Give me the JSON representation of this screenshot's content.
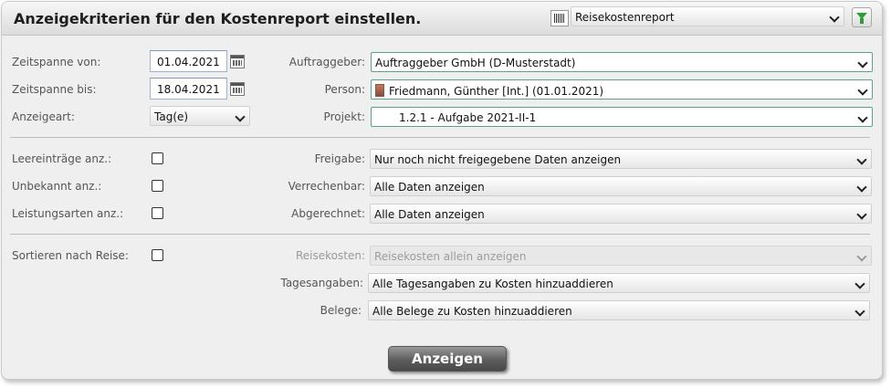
{
  "header": {
    "title": "Anzeigekriterien für den Kostenreport einstellen.",
    "report_select": "Reisekostenreport"
  },
  "row1": {
    "from_label": "Zeitspanne von:",
    "from_value": "01.04.2021",
    "client_label": "Auftraggeber:",
    "client_value": "Auftraggeber GmbH (D-Musterstadt)"
  },
  "row2": {
    "to_label": "Zeitspanne bis:",
    "to_value": "18.04.2021",
    "person_label": "Person:",
    "person_value": "Friedmann, Günther [Int.] (01.01.2021)"
  },
  "row3": {
    "display_label": "Anzeigeart:",
    "display_value": "Tag(e)",
    "project_label": "Projekt:",
    "project_value": "1.2.1 - Aufgabe 2021-II-1"
  },
  "section2": {
    "empty_label": "Leereinträge anz.:",
    "unknown_label": "Unbekannt anz.:",
    "services_label": "Leistungsarten anz.:",
    "release_label": "Freigabe:",
    "release_value": "Nur noch nicht freigegebene Daten anzeigen",
    "billable_label": "Verrechenbar:",
    "billable_value": "Alle Daten anzeigen",
    "settled_label": "Abgerechnet:",
    "settled_value": "Alle Daten anzeigen"
  },
  "section3": {
    "sort_label": "Sortieren nach Reise:",
    "travel_label": "Reisekosten:",
    "travel_value": "Reisekosten allein anzeigen",
    "daily_label": "Tagesangaben:",
    "daily_value": "Alle Tagesangaben zu Kosten hinzuaddieren",
    "receipts_label": "Belege:",
    "receipts_value": "Alle Belege zu Kosten hinzuaddieren"
  },
  "actions": {
    "show_label": "Anzeigen"
  },
  "colors": {
    "accent_border": "#5aa383",
    "button_dark": "#4a4a4a",
    "filter_icon": "#2f9e3a"
  },
  "icons": [
    "report-icon",
    "filter-icon",
    "calendar-icon",
    "chevron-down-icon",
    "person-icon"
  ]
}
